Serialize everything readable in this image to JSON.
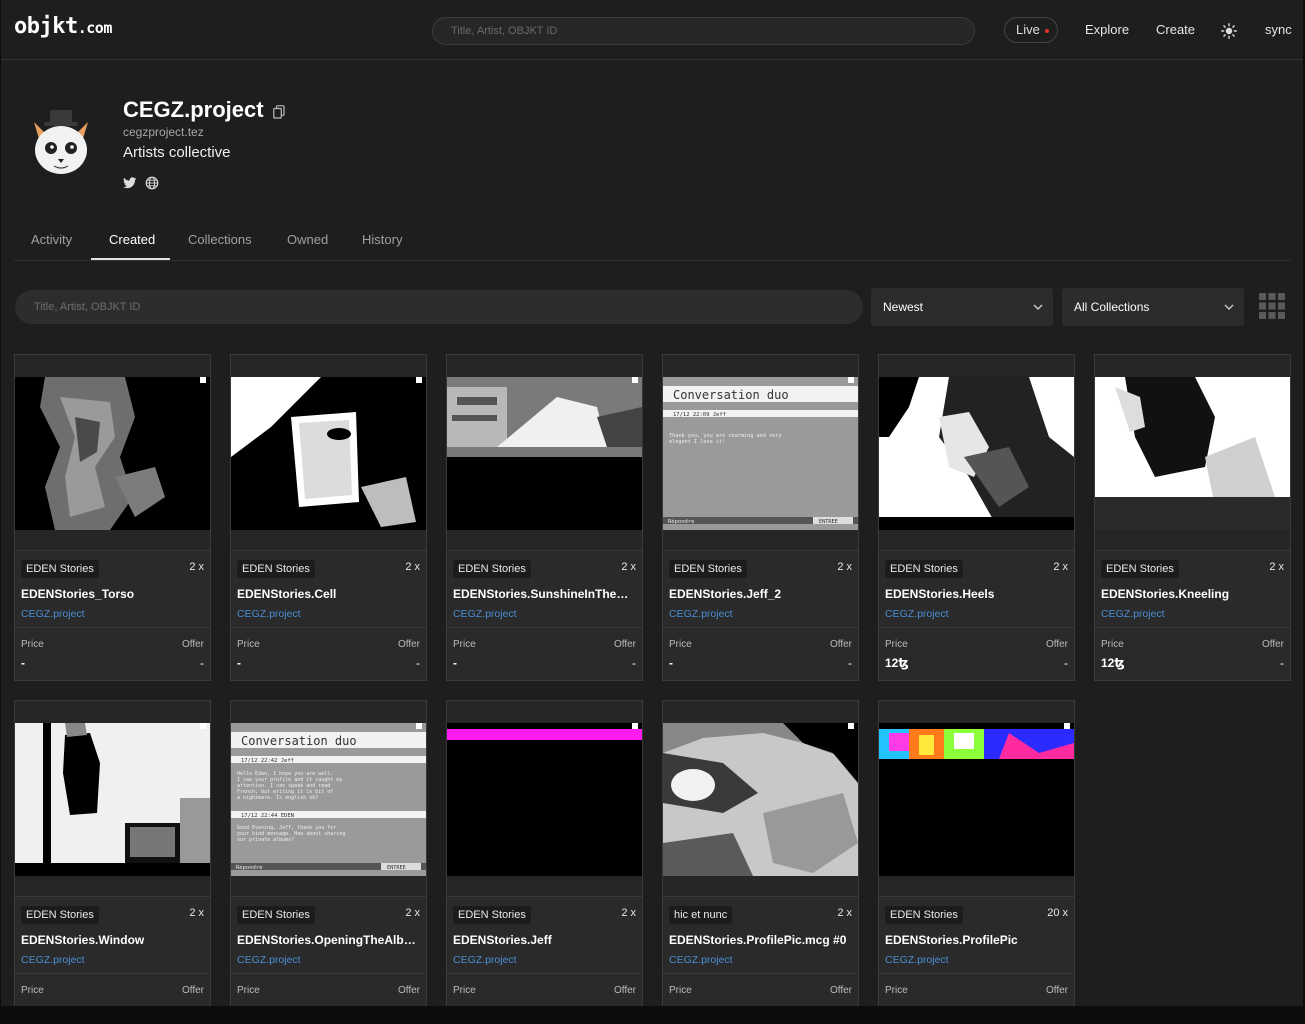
{
  "header": {
    "logo_main": "objkt",
    "logo_dot": ".com",
    "search_placeholder": "Title, Artist, OBJKT ID",
    "live_label": "Live",
    "nav": [
      "Explore",
      "Create"
    ],
    "sync_label": "sync"
  },
  "profile": {
    "name": "CEGZ.project",
    "address": "cegzproject.tez",
    "description": "Artists collective",
    "socials": [
      "twitter-icon",
      "globe-icon"
    ]
  },
  "tabs": [
    {
      "label": "Activity",
      "active": false
    },
    {
      "label": "Created",
      "active": true
    },
    {
      "label": "Collections",
      "active": false
    },
    {
      "label": "Owned",
      "active": false
    },
    {
      "label": "History",
      "active": false
    }
  ],
  "filters": {
    "search_placeholder": "Title, Artist, OBJKT ID",
    "sort": "Newest",
    "collection": "All Collections"
  },
  "tokens": [
    {
      "collection": "EDEN Stories",
      "editions": "2 x",
      "title": "EDENStories_Torso",
      "artist": "CEGZ.project",
      "price_label": "Price",
      "offer_label": "Offer",
      "price": "-",
      "offer": "-",
      "art": "torso"
    },
    {
      "collection": "EDEN Stories",
      "editions": "2 x",
      "title": "EDENStories.Cell",
      "artist": "CEGZ.project",
      "price_label": "Price",
      "offer_label": "Offer",
      "price": "-",
      "offer": "-",
      "art": "cell"
    },
    {
      "collection": "EDEN Stories",
      "editions": "2 x",
      "title": "EDENStories.SunshineInTheBedroom",
      "artist": "CEGZ.project",
      "price_label": "Price",
      "offer_label": "Offer",
      "price": "-",
      "offer": "-",
      "art": "sunshine"
    },
    {
      "collection": "EDEN Stories",
      "editions": "2 x",
      "title": "EDENStories.Jeff_2",
      "artist": "CEGZ.project",
      "price_label": "Price",
      "offer_label": "Offer",
      "price": "-",
      "offer": "-",
      "art": "convo1"
    },
    {
      "collection": "EDEN Stories",
      "editions": "2 x",
      "title": "EDENStories.Heels",
      "artist": "CEGZ.project",
      "price_label": "Price",
      "offer_label": "Offer",
      "price": "12ꜩ",
      "offer": "-",
      "art": "heels"
    },
    {
      "collection": "EDEN Stories",
      "editions": "2 x",
      "title": "EDENStories.Kneeling",
      "artist": "CEGZ.project",
      "price_label": "Price",
      "offer_label": "Offer",
      "price": "12ꜩ",
      "offer": "-",
      "art": "kneeling"
    },
    {
      "collection": "EDEN Stories",
      "editions": "2 x",
      "title": "EDENStories.Window",
      "artist": "CEGZ.project",
      "price_label": "Price",
      "offer_label": "Offer",
      "price": "",
      "offer": "",
      "art": "window"
    },
    {
      "collection": "EDEN Stories",
      "editions": "2 x",
      "title": "EDENStories.OpeningTheAlbums",
      "artist": "CEGZ.project",
      "price_label": "Price",
      "offer_label": "Offer",
      "price": "",
      "offer": "",
      "art": "convo2"
    },
    {
      "collection": "EDEN Stories",
      "editions": "2 x",
      "title": "EDENStories.Jeff",
      "artist": "CEGZ.project",
      "price_label": "Price",
      "offer_label": "Offer",
      "price": "",
      "offer": "",
      "art": "jeff"
    },
    {
      "collection": "hic et nunc",
      "editions": "2 x",
      "title": "EDENStories.ProfilePic.mcg #0",
      "artist": "CEGZ.project",
      "price_label": "Price",
      "offer_label": "Offer",
      "price": "",
      "offer": "",
      "art": "eye"
    },
    {
      "collection": "EDEN Stories",
      "editions": "20 x",
      "title": "EDENStories.ProfilePic",
      "artist": "CEGZ.project",
      "price_label": "Price",
      "offer_label": "Offer",
      "price": "",
      "offer": "",
      "art": "profilepic"
    }
  ],
  "art_screens": {
    "convo1": {
      "heading": "Conversation duo",
      "stamp": "17/12 22:09 Jeff",
      "body": [
        "Thank you, you are charming and very",
        "elegant I love it!"
      ],
      "reply": "Répondre",
      "send": "ENTREE"
    },
    "convo2": {
      "heading": "Conversation duo",
      "stamp": "17/12 22:42 Jeff",
      "body": [
        "Hello Eden, I hope you are well.",
        "I saw your profile and it caught my",
        "attention. I can speak and read",
        "French, but writing it is bit of",
        "a nightmare. Is english ok?"
      ],
      "stamp2": "17/12 22:44 EDEN",
      "body2": [
        "Good Evening, Jeff, thank you for",
        "your kind message. How about sharing",
        "our private albums?"
      ],
      "reply": "Répondre",
      "send": "ENTREE"
    }
  }
}
